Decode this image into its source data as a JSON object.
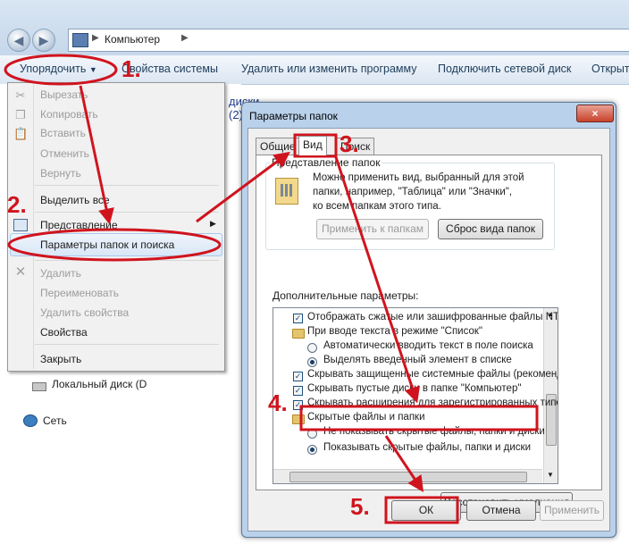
{
  "breadcrumb": {
    "location": "Компьютер"
  },
  "toolbar": {
    "organize": "Упорядочить",
    "system_properties": "Свойства системы",
    "uninstall": "Удалить или изменить программу",
    "map_drive": "Подключить сетевой диск",
    "open": "Открыть"
  },
  "background": {
    "disks_heading": "диски (2)",
    "local_disk": "Локальный диск (D",
    "network": "Сеть"
  },
  "menu": {
    "cut": "Вырезать",
    "copy": "Копировать",
    "paste": "Вставить",
    "undo": "Отменить",
    "redo": "Вернуть",
    "select_all": "Выделить все",
    "view": "Представление",
    "folder_options": "Параметры папок и поиска",
    "delete": "Удалить",
    "rename": "Переименовать",
    "remove_properties": "Удалить свойства",
    "properties": "Свойства",
    "close": "Закрыть"
  },
  "dialog": {
    "title": "Параметры папок",
    "close_icon": "×",
    "tabs": {
      "general": "Общие",
      "view": "Вид",
      "search": "Поиск"
    },
    "group_title": "Представление папок",
    "group_text_1": "Можно применить вид, выбранный для этой",
    "group_text_2": "папки, например, \"Таблица\" или \"Значки\",",
    "group_text_3": "ко всем папкам этого типа.",
    "apply_to_folders": "Применить к папкам",
    "reset_folders": "Сброс вида папок",
    "advanced_label": "Дополнительные параметры:",
    "tree": [
      "Отображать сжатые или зашифрованные файлы NTFS",
      "При вводе текста в режиме \"Список\"",
      "Автоматически вводить текст в поле поиска",
      "Выделять введенный элемент в списке",
      "Скрывать защищенные системные файлы (рекомендуется)",
      "Скрывать пустые диски в папке \"Компьютер\"",
      "Скрывать расширения для зарегистрированных типов",
      "Скрытые файлы и папки",
      "Не показывать скрытые файлы, папки и диски",
      "Показывать скрытые файлы, папки и диски"
    ],
    "restore_defaults": "Восстановить умолчания",
    "ok": "ОК",
    "cancel": "Отмена",
    "apply": "Применить"
  },
  "annotations": {
    "step1": "1.",
    "step2": "2.",
    "step3": "3.",
    "step4": "4.",
    "step5": "5."
  },
  "colors": {
    "annotation_red": "#d0141e"
  }
}
